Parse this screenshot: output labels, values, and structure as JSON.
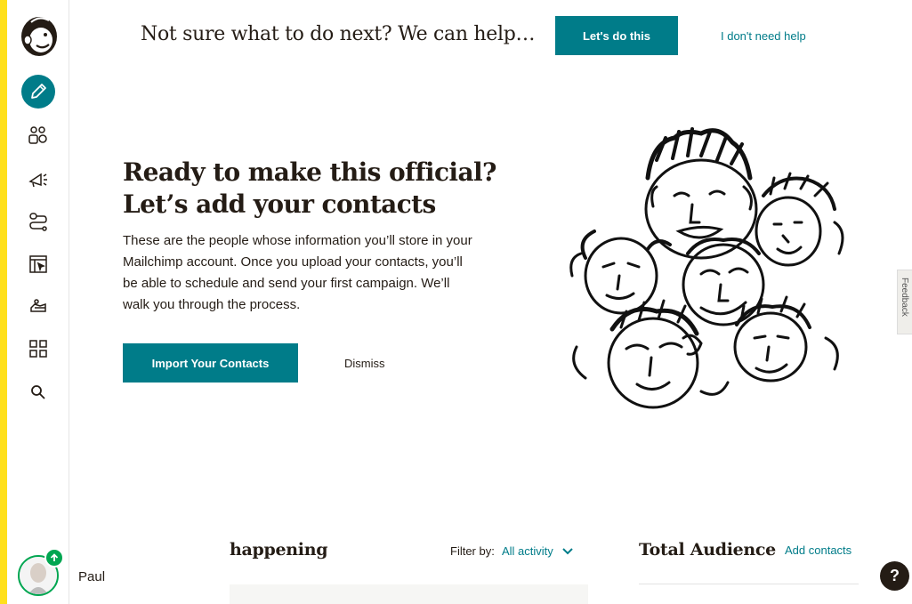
{
  "topbar": {
    "help_text": "Not sure what to do next? We can help…",
    "primary_button": "Let's do this",
    "dismiss_link": "I don't need help"
  },
  "sidebar": {
    "items": [
      {
        "icon": "pencil-icon",
        "active": true
      },
      {
        "icon": "audience-icon"
      },
      {
        "icon": "megaphone-icon"
      },
      {
        "icon": "automation-icon"
      },
      {
        "icon": "website-icon"
      },
      {
        "icon": "content-studio-icon"
      },
      {
        "icon": "integrations-grid-icon"
      },
      {
        "icon": "search-icon"
      }
    ],
    "user_name": "Paul"
  },
  "hero": {
    "title_line1": "Ready to make this official?",
    "title_line2": "Let’s add your contacts",
    "body": "These are the people whose information you’ll store in your Mailchimp account. Once you upload your contacts, you’ll be able to schedule and send your first campaign. We’ll walk you through the process.",
    "import_button": "Import Your Contacts",
    "dismiss_link": "Dismiss"
  },
  "feedback_tab": "Feedback",
  "activity": {
    "title": "happening",
    "filter_label": "Filter by:",
    "filter_value": "All activity"
  },
  "audience": {
    "title": "Total Audience",
    "add_link": "Add contacts"
  },
  "help_button": "?",
  "colors": {
    "brand_yellow": "#ffe01b",
    "accent_teal": "#007c89",
    "text_dark": "#241c15",
    "status_green": "#00a651"
  }
}
